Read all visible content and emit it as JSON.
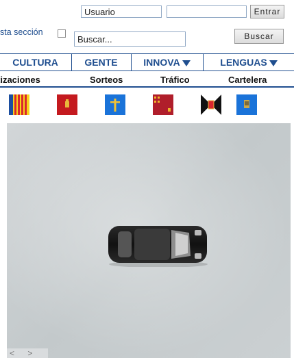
{
  "login": {
    "username_placeholder": "Usuario",
    "password_value": "",
    "submit_label": "Entrar"
  },
  "search": {
    "scope_label": "sta sección",
    "placeholder": "Buscar...",
    "submit_label": "Buscar"
  },
  "nav": {
    "items": [
      {
        "label": "CULTURA",
        "has_menu": false
      },
      {
        "label": "GENTE",
        "has_menu": false
      },
      {
        "label": "INNOVA",
        "has_menu": true
      },
      {
        "label": "LENGUAS",
        "has_menu": true
      }
    ],
    "color": "#1f4e8f"
  },
  "sub_links": [
    "tizaciones",
    "Sorteos",
    "Tráfico",
    "Cartelera"
  ],
  "flags": [
    {
      "name": "valencia-flag-icon"
    },
    {
      "name": "madrid-region-flag-icon"
    },
    {
      "name": "asturias-flag-icon"
    },
    {
      "name": "murcia-flag-icon"
    },
    {
      "name": "ceuta-flag-icon"
    },
    {
      "name": "melilla-flag-icon"
    }
  ],
  "viewer": {
    "scroll_arrows": "< >"
  }
}
